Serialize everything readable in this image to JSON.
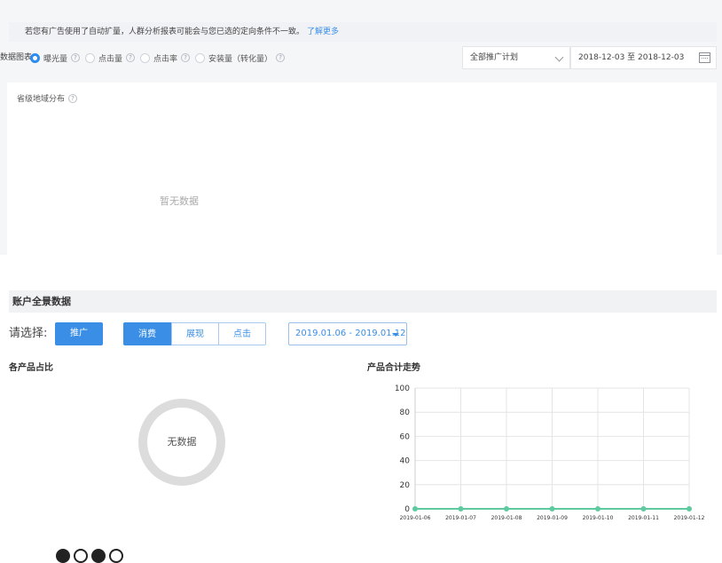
{
  "top": {
    "notice": "若您有广告使用了自动扩量，人群分析报表可能会与您已选的定向条件不一致。",
    "notice_link": "了解更多",
    "filter_label": "数据图表",
    "metrics": [
      {
        "label": "曝光量",
        "checked": true
      },
      {
        "label": "点击量",
        "checked": false
      },
      {
        "label": "点击率",
        "checked": false
      },
      {
        "label": "安装量（转化量）",
        "checked": false
      }
    ],
    "help_glyph": "?",
    "plan_select": "全部推广计划",
    "date_range": "2018-12-03 至 2018-12-03",
    "map_title": "省级地域分布",
    "no_data": "暂无数据"
  },
  "account": {
    "header": "账户全景数据",
    "select_label": "请选择:",
    "promo_button": "推广",
    "segments": [
      {
        "label": "消费",
        "active": true
      },
      {
        "label": "展现",
        "active": false
      },
      {
        "label": "点击",
        "active": false
      }
    ],
    "date_select": "2019.01.06 - 2019.01.12",
    "pie_title": "各产品占比",
    "pie_empty": "无数据",
    "line_title": "产品合计走势"
  },
  "chart_data": {
    "type": "line",
    "title": "产品合计走势",
    "x": [
      "2019-01-06",
      "2019-01-07",
      "2019-01-08",
      "2019-01-09",
      "2019-01-10",
      "2019-01-11",
      "2019-01-12"
    ],
    "series": [
      {
        "values": [
          0,
          0,
          0,
          0,
          0,
          0,
          0
        ]
      }
    ],
    "ylim": [
      0,
      100
    ],
    "yticks": [
      0,
      20,
      40,
      60,
      80,
      100
    ],
    "grid": true,
    "line_color": "#5fc9a0"
  },
  "pager": {
    "filled": [
      true,
      false,
      true,
      false
    ]
  },
  "colors": {
    "primary": "#3a8ee6",
    "link": "#3b8fe8",
    "donut": "#dcdcdc"
  }
}
